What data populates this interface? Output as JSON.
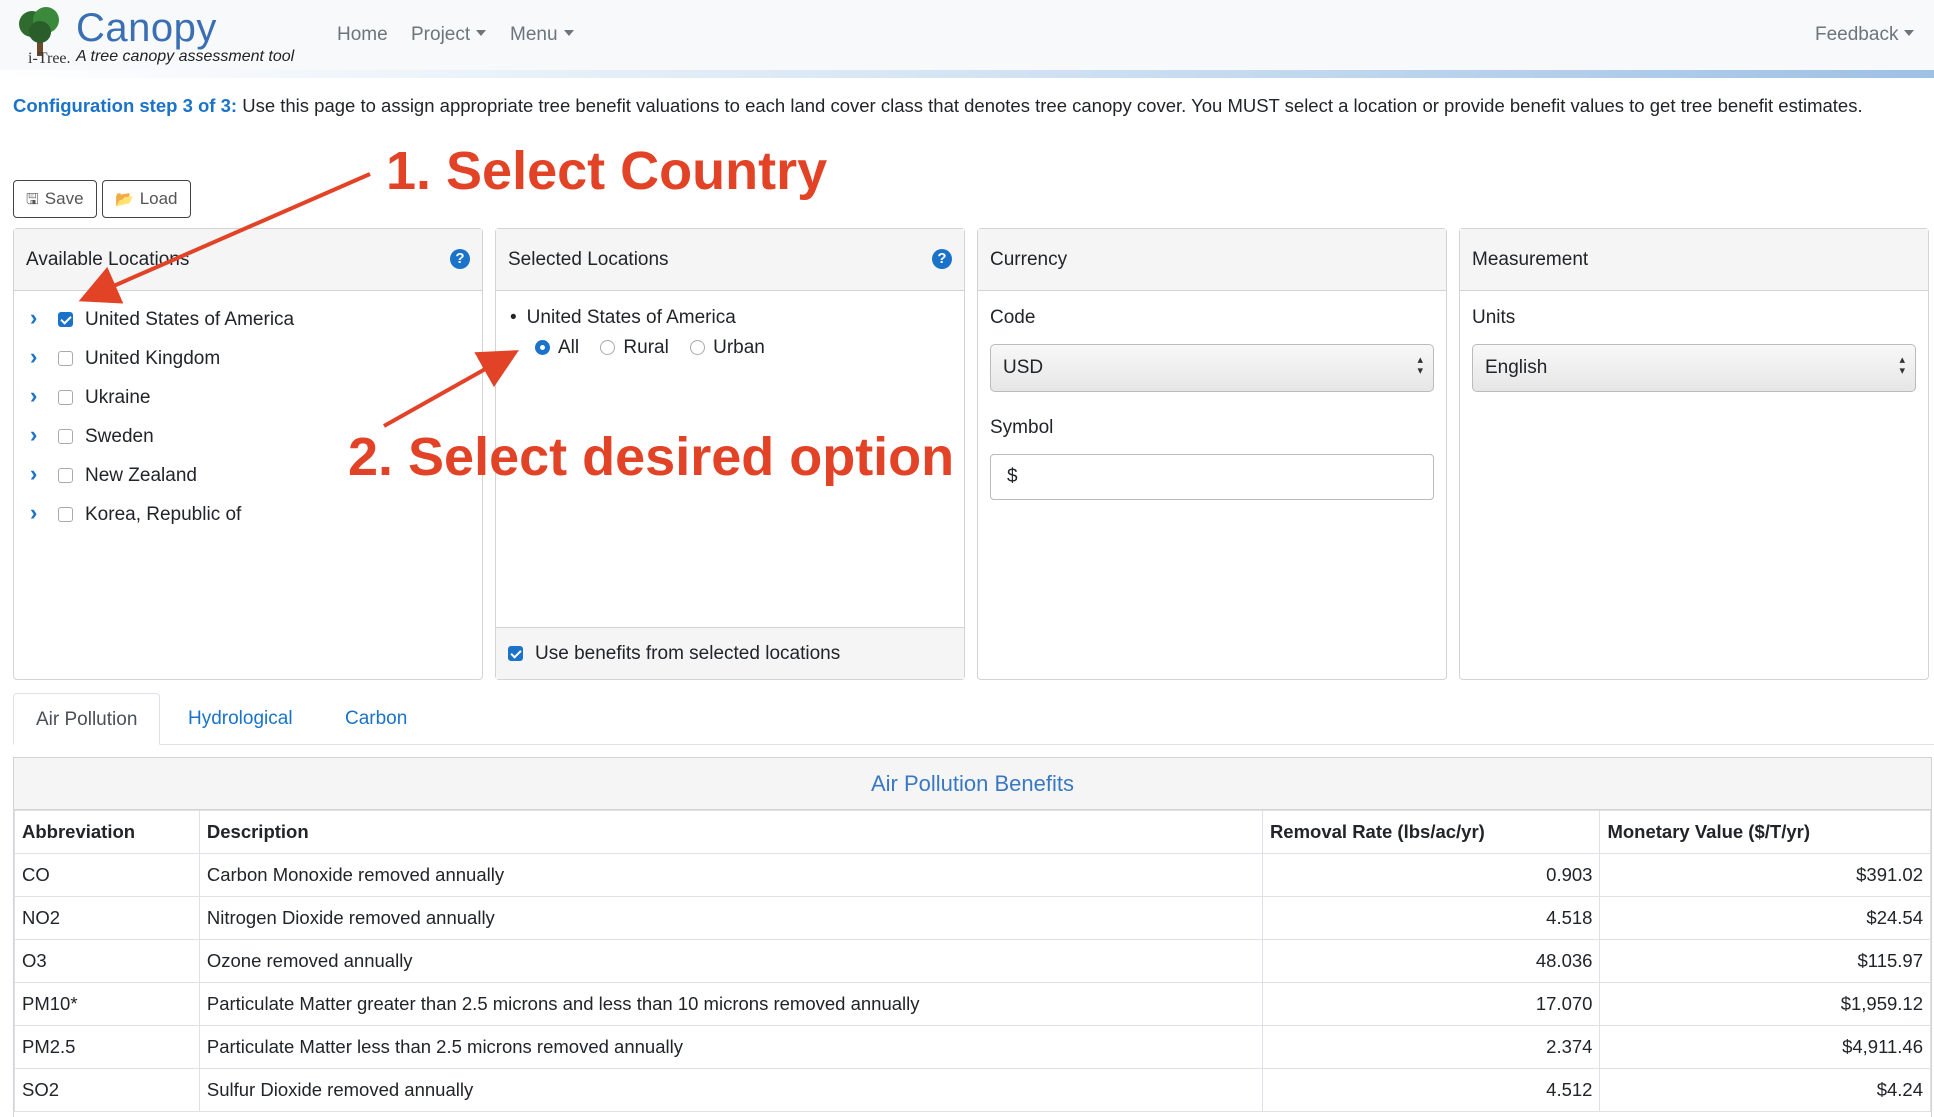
{
  "header": {
    "brand_title": "Canopy",
    "brand_tagline": "A tree canopy assessment tool",
    "logo_text": "i-Tree.",
    "nav": [
      {
        "label": "Home"
      },
      {
        "label": "Project"
      },
      {
        "label": "Menu"
      }
    ],
    "feedback_label": "Feedback"
  },
  "intro": {
    "step_label": "Configuration step 3 of 3:",
    "text": " Use this page to assign appropriate tree benefit valuations to each land cover class that denotes tree canopy cover. You MUST select a location or provide benefit values to get tree benefit estimates."
  },
  "toolbar": {
    "save_label": "Save",
    "load_label": "Load"
  },
  "available_locations": {
    "title": "Available Locations",
    "items": [
      {
        "label": "United States of America",
        "checked": true
      },
      {
        "label": "United Kingdom",
        "checked": false
      },
      {
        "label": "Ukraine",
        "checked": false
      },
      {
        "label": "Sweden",
        "checked": false
      },
      {
        "label": "New Zealand",
        "checked": false
      },
      {
        "label": "Korea, Republic of",
        "checked": false
      }
    ]
  },
  "selected_locations": {
    "title": "Selected Locations",
    "location": "United States of America",
    "options": [
      {
        "label": "All",
        "selected": true
      },
      {
        "label": "Rural",
        "selected": false
      },
      {
        "label": "Urban",
        "selected": false
      }
    ],
    "use_benefits_label": "Use benefits from selected locations",
    "use_benefits_checked": true
  },
  "currency": {
    "title": "Currency",
    "code_label": "Code",
    "code_value": "USD",
    "symbol_label": "Symbol",
    "symbol_value": "$"
  },
  "measurement": {
    "title": "Measurement",
    "units_label": "Units",
    "units_value": "English"
  },
  "tabs": [
    {
      "label": "Air Pollution",
      "active": true
    },
    {
      "label": "Hydrological",
      "active": false
    },
    {
      "label": "Carbon",
      "active": false
    }
  ],
  "benefits_table": {
    "title": "Air Pollution Benefits",
    "columns": [
      "Abbreviation",
      "Description",
      "Removal Rate (lbs/ac/yr)",
      "Monetary Value ($/T/yr)"
    ],
    "rows": [
      [
        "CO",
        "Carbon Monoxide removed annually",
        "0.903",
        "$391.02"
      ],
      [
        "NO2",
        "Nitrogen Dioxide removed annually",
        "4.518",
        "$24.54"
      ],
      [
        "O3",
        "Ozone removed annually",
        "48.036",
        "$115.97"
      ],
      [
        "PM10*",
        "Particulate Matter greater than 2.5 microns and less than 10 microns removed annually",
        "17.070",
        "$1,959.12"
      ],
      [
        "PM2.5",
        "Particulate Matter less than 2.5 microns removed annually",
        "2.374",
        "$4,911.46"
      ],
      [
        "SO2",
        "Sulfur Dioxide removed annually",
        "4.512",
        "$4.24"
      ]
    ]
  },
  "annotations": {
    "step1": "1. Select Country",
    "step2": "2. Select desired option",
    "color": "#e24327"
  },
  "colors": {
    "accent": "#1a73c9",
    "annotation": "#e24327"
  }
}
